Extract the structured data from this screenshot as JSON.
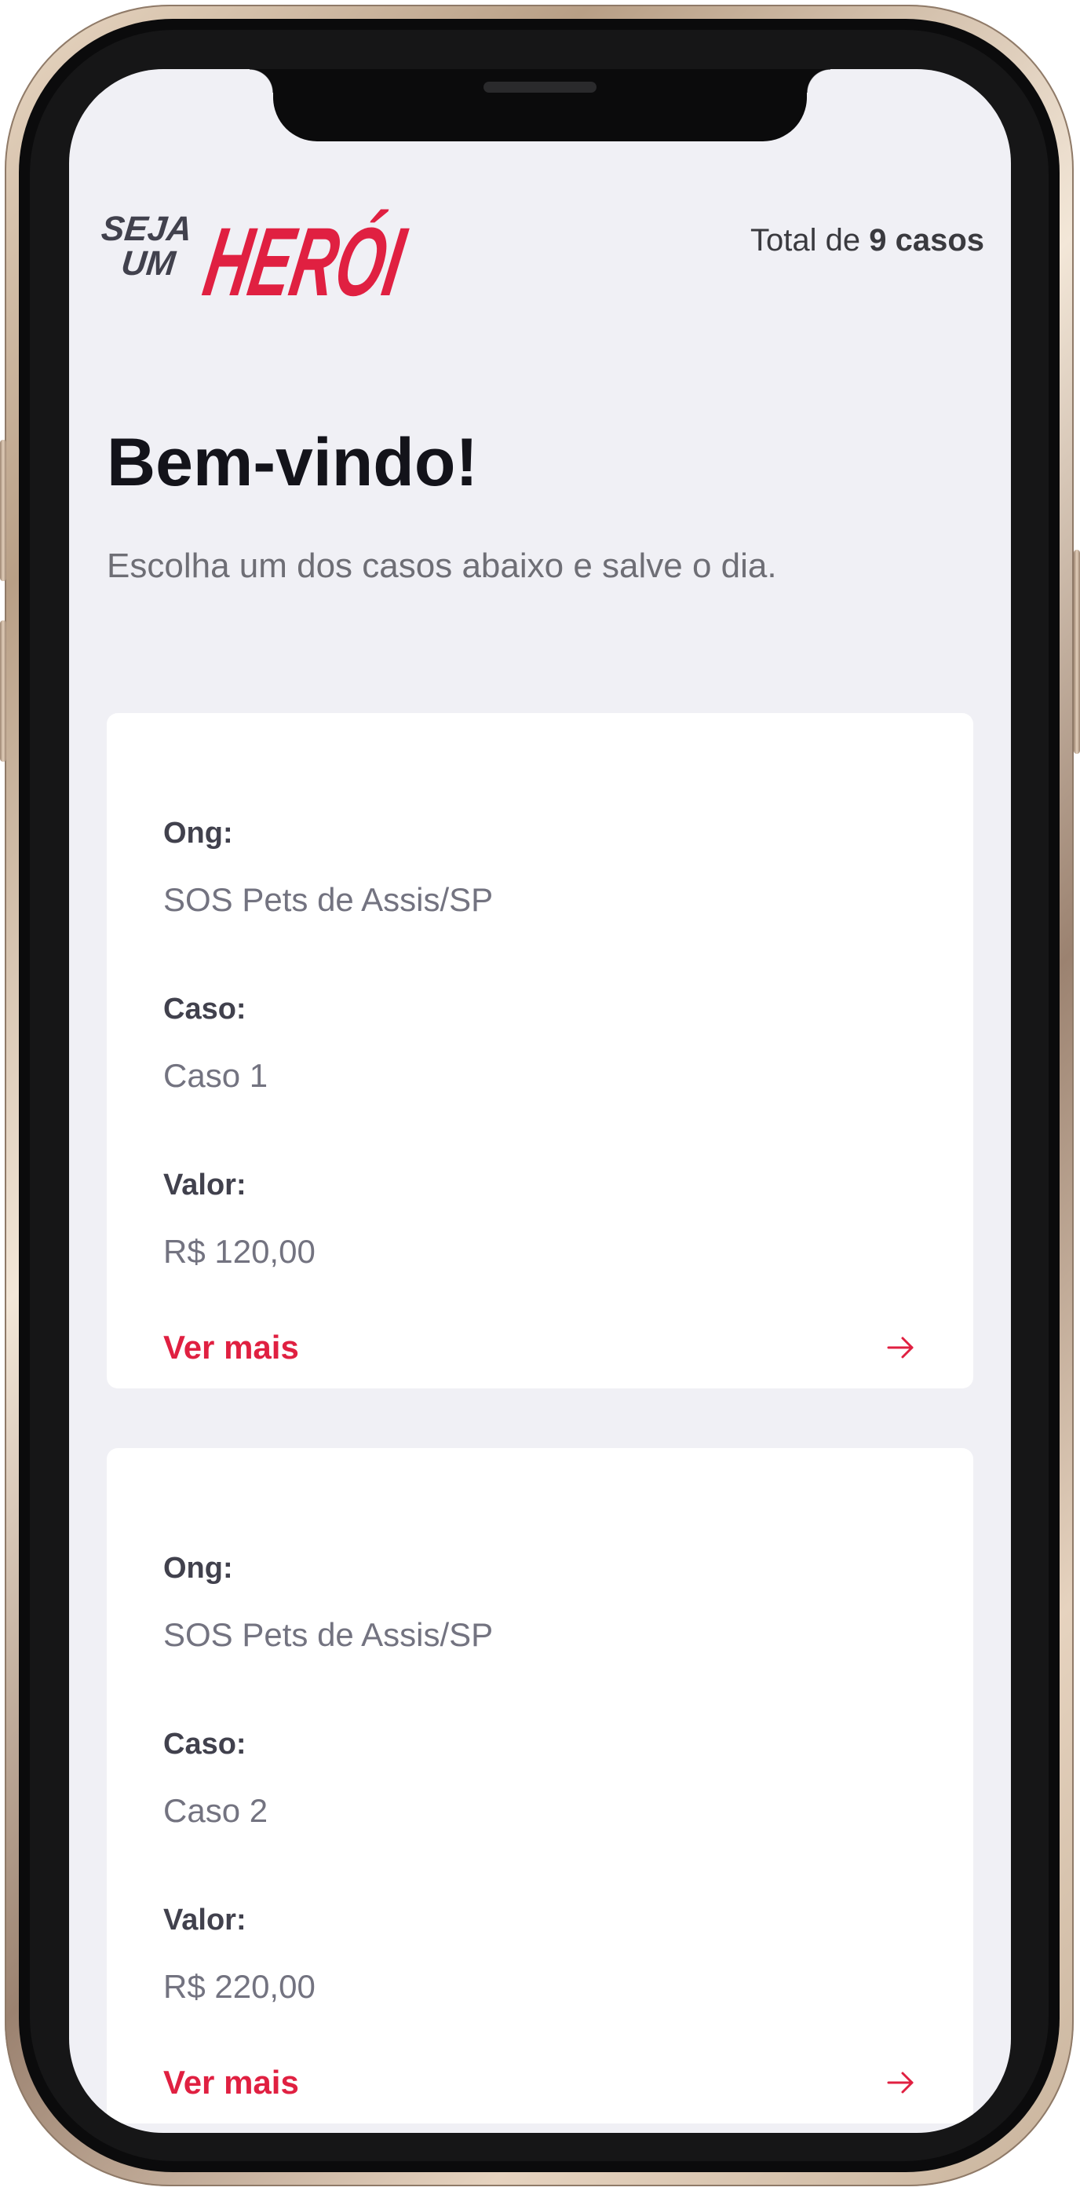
{
  "header": {
    "logo_text_small_1": "SEJA",
    "logo_text_small_2": "UM",
    "logo_text_big": "HERÓI",
    "total_prefix": "Total de",
    "total_count": "9 casos"
  },
  "main": {
    "title": "Bem-vindo!",
    "subtitle": "Escolha um dos casos abaixo e salve o dia."
  },
  "incidents": [
    {
      "ong_label": "Ong:",
      "ong_value": "SOS Pets de Assis/SP",
      "caso_label": "Caso:",
      "caso_value": "Caso 1",
      "valor_label": "Valor:",
      "valor_value": "R$ 120,00",
      "link_label": "Ver mais"
    },
    {
      "ong_label": "Ong:",
      "ong_value": "SOS Pets de Assis/SP",
      "caso_label": "Caso:",
      "caso_value": "Caso 2",
      "valor_label": "Valor:",
      "valor_value": "R$ 220,00",
      "link_label": "Ver mais"
    }
  ],
  "colors": {
    "brand": "#e02041",
    "background": "#f0f0f5",
    "card": "#ffffff",
    "title": "#13131a",
    "label": "#41414d",
    "value": "#737380"
  },
  "icons": {
    "link_arrow": "arrow-right-icon"
  }
}
